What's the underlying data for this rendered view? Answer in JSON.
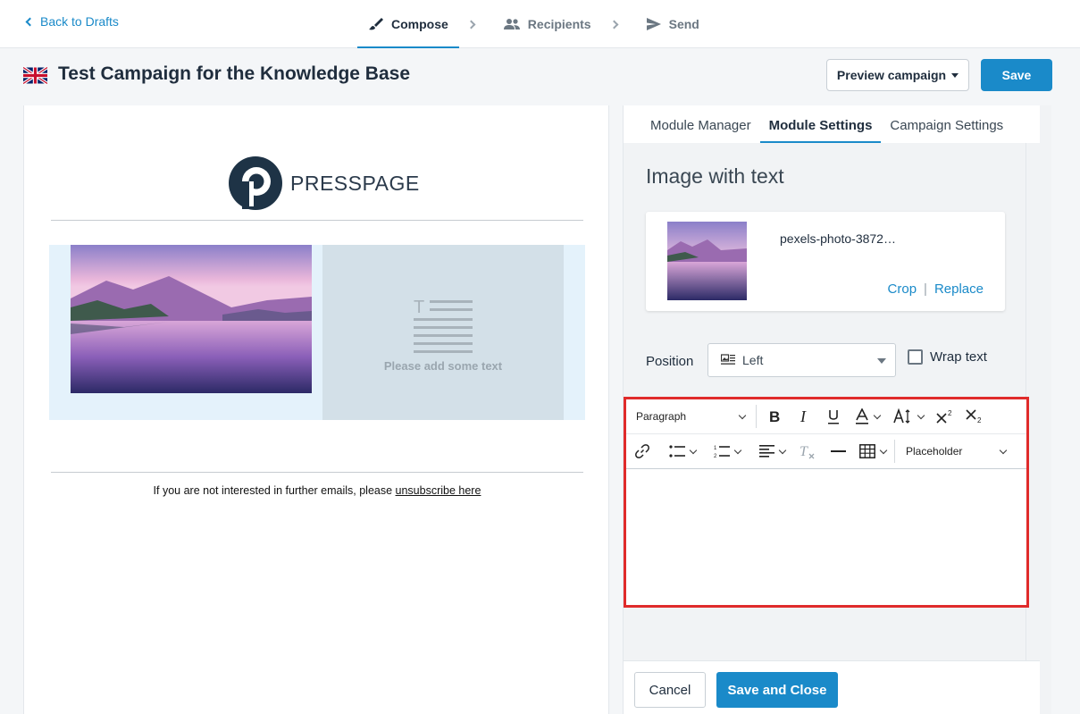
{
  "nav": {
    "back_label": "Back to Drafts",
    "steps": [
      {
        "label": "Compose",
        "icon": "brush-icon"
      },
      {
        "label": "Recipients",
        "icon": "people-icon"
      },
      {
        "label": "Send",
        "icon": "send-icon"
      }
    ],
    "active_step": "Compose"
  },
  "header": {
    "flag_icon": "uk-flag-icon",
    "title": "Test Campaign for the Knowledge Base",
    "preview_label": "Preview campaign",
    "save_label": "Save"
  },
  "canvas": {
    "logo_text": "PRESSPAGE",
    "placeholder_text": "Please add some text",
    "footer_prefix": "If you are not interested in further emails, please ",
    "footer_link": "unsubscribe here"
  },
  "panel": {
    "tabs": [
      "Module Manager",
      "Module Settings",
      "Campaign Settings"
    ],
    "active_tab": "Module Settings",
    "module_title": "Image with text",
    "file_name": "pexels-photo-3872…",
    "crop_label": "Crop",
    "replace_label": "Replace",
    "position_label": "Position",
    "position_value": "Left",
    "wrap_label": "Wrap text",
    "wrap_checked": false,
    "toolbar": {
      "block_format": "Paragraph",
      "placeholder_select": "Placeholder"
    },
    "cancel_label": "Cancel",
    "save_close_label": "Save and Close"
  },
  "colors": {
    "accent": "#1a8ac9",
    "highlight_border": "#e02b2b",
    "module_bg": "#e4f2fb"
  }
}
